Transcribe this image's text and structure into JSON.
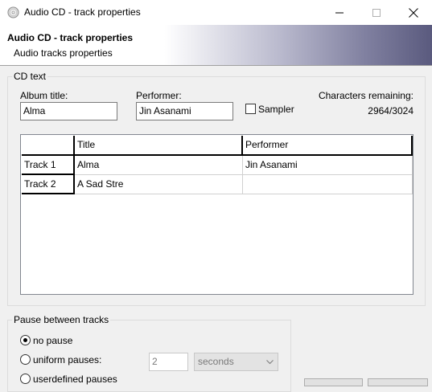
{
  "window": {
    "title": "Audio CD - track properties",
    "minimize_icon": "minimize-icon",
    "maximize_icon": "maximize-icon",
    "close_icon": "close-icon"
  },
  "header": {
    "title": "Audio CD - track properties",
    "subtitle": "Audio tracks properties"
  },
  "cd_text": {
    "group_label": "CD text",
    "album_title_label": "Album title:",
    "album_title_value": "Alma",
    "performer_label": "Performer:",
    "performer_value": "Jin Asanami",
    "sampler_label": "Sampler",
    "sampler_checked": false,
    "chars_remaining_label": "Characters remaining:",
    "chars_remaining_value": "2964/3024"
  },
  "tracks_table": {
    "columns": [
      "Title",
      "Performer"
    ],
    "rows": [
      {
        "header": "Track 1",
        "title": "Alma",
        "performer": "Jin Asanami"
      },
      {
        "header": "Track 2",
        "title": "A Sad Stre",
        "performer": ""
      }
    ]
  },
  "pause": {
    "group_label": "Pause between tracks",
    "options": [
      "no pause",
      "uniform pauses:",
      "userdefined pauses"
    ],
    "selected": "no pause",
    "seconds_value": "2",
    "unit_value": "seconds"
  }
}
